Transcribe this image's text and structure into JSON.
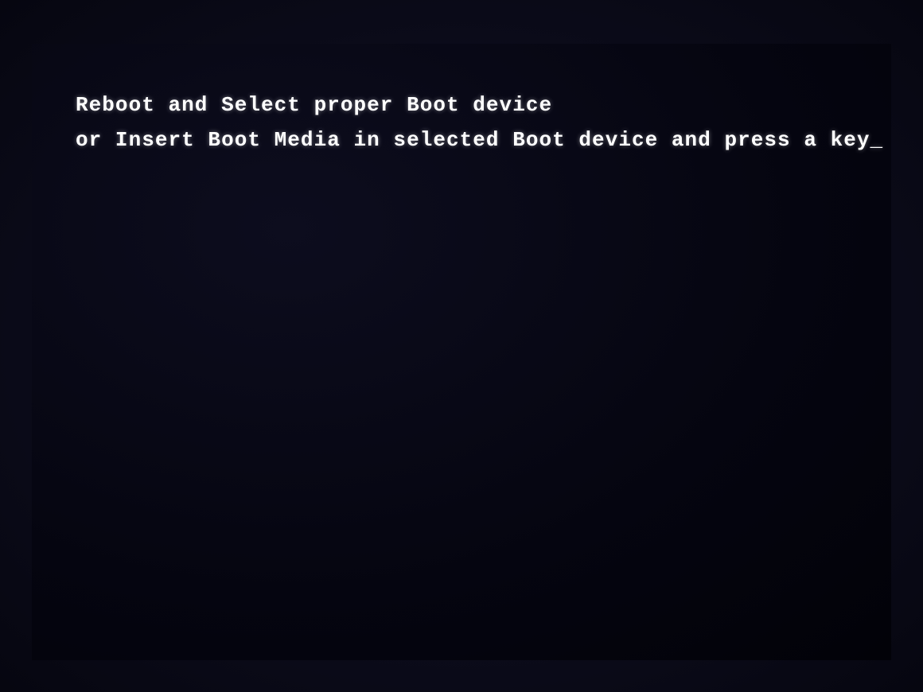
{
  "screen": {
    "background_color": "#080812",
    "border_color": "#1a1a2e"
  },
  "boot_message": {
    "line1": "Reboot and Select proper Boot device",
    "line2": "or Insert Boot Media in selected Boot device and press a key_"
  }
}
